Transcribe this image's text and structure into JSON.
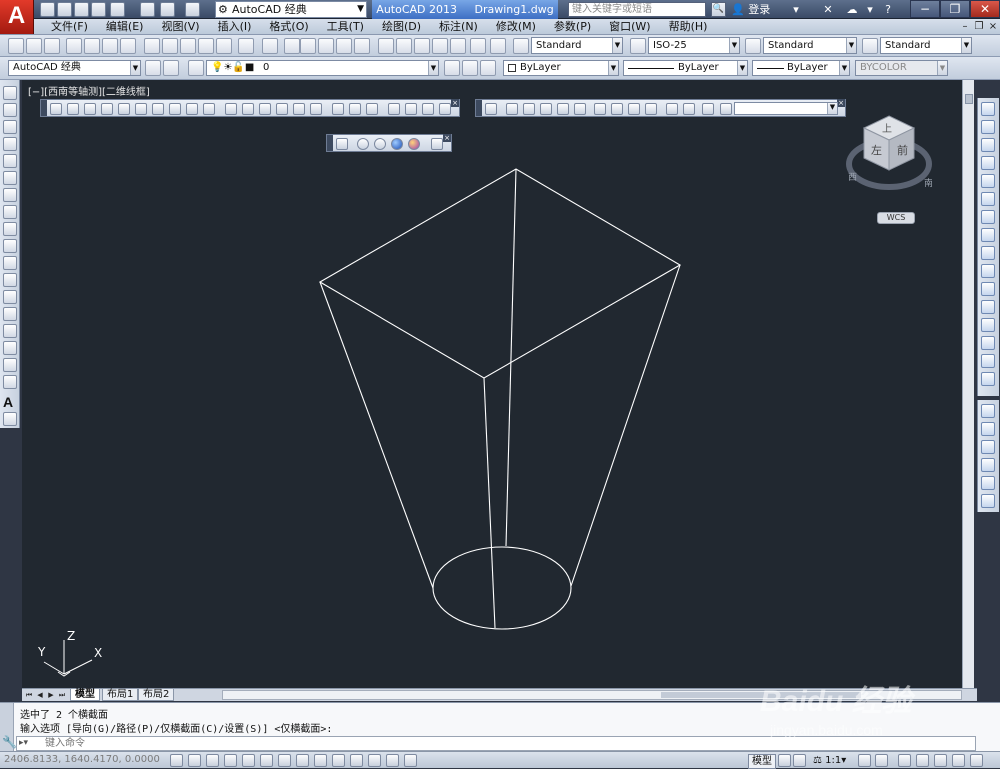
{
  "title_bar": {
    "workspace": "AutoCAD 经典",
    "app_title": "AutoCAD 2013",
    "document": "Drawing1.dwg",
    "search_placeholder": "键入关键字或短语",
    "login_label": "登录",
    "help_label": "?"
  },
  "menu": {
    "items": [
      "文件(F)",
      "编辑(E)",
      "视图(V)",
      "插入(I)",
      "格式(O)",
      "工具(T)",
      "绘图(D)",
      "标注(N)",
      "修改(M)",
      "参数(P)",
      "窗口(W)",
      "帮助(H)"
    ]
  },
  "standard_toolbar": {
    "text_style": "Standard",
    "dim_style": "ISO-25",
    "table_style": "Standard",
    "multileader_style": "Standard"
  },
  "layers_toolbar": {
    "workspace": "AutoCAD 经典",
    "current_layer": "0",
    "color": "ByLayer",
    "linetype": "ByLayer",
    "lineweight": "ByLayer",
    "plot_style": "BYCOLOR"
  },
  "viewport": {
    "label": "[−][西南等轴测][二维线框]",
    "ucs_axes": {
      "x": "X",
      "y": "Y",
      "z": "Z"
    }
  },
  "viewcube": {
    "top_face": "上",
    "left_face": "左",
    "front_face": "前",
    "compass_west": "西",
    "compass_south": "南",
    "wcs": "WCS"
  },
  "tabs": {
    "items": [
      "模型",
      "布局1",
      "布局2"
    ],
    "active": "模型"
  },
  "command": {
    "history_line1": "选中了 2 个横截面",
    "history_line2": "输入选项 [导向(G)/路径(P)/仅横截面(C)/设置(S)] <仅横截面>:",
    "input_placeholder": "键入命令"
  },
  "status_bar": {
    "coordinates": "2406.8133, 1640.4170, 0.0000",
    "model_label": "模型",
    "annotation_scale": "1:1"
  },
  "watermark": {
    "brand": "Baidu 经验",
    "site": "jingyan.baidu.com"
  },
  "colors": {
    "canvas_background": "#212830",
    "geometry_stroke": "#ffffff",
    "title_bar_accent": "#3d6fc4",
    "logo_red": "#d4281b"
  }
}
